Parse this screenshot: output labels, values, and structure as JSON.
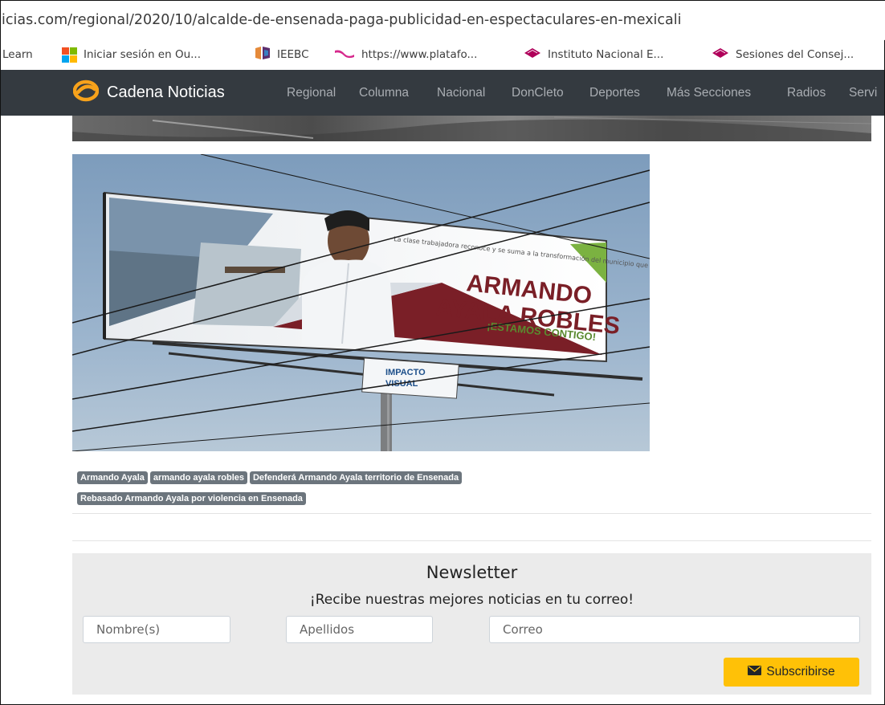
{
  "browser": {
    "url": "icias.com/regional/2020/10/alcalde-de-ensenada-paga-publicidad-en-espectaculares-en-mexicali",
    "bookmarks": [
      {
        "label": "Learn",
        "icon": "learn-bookmark"
      },
      {
        "label": "Iniciar sesión en Ou...",
        "icon": "microsoft-logo-icon"
      },
      {
        "label": "IEEBC",
        "icon": "ieebc-logo-icon"
      },
      {
        "label": "https://www.platafo...",
        "icon": "platform-logo-icon"
      },
      {
        "label": "Instituto Nacional E...",
        "icon": "ine-logo-icon"
      },
      {
        "label": "Sesiones del Consej...",
        "icon": "ine-logo-icon"
      }
    ]
  },
  "navbar": {
    "brand": "Cadena Noticias",
    "links": [
      "Regional",
      "Columna",
      "Nacional",
      "DonCleto",
      "Deportes",
      "Más Secciones",
      "Radios",
      "Servi"
    ]
  },
  "photo": {
    "billboard_text": {
      "slogan": "La clase trabajadora reconoce y se suma a la transformación del municipio que ha emprendido",
      "name_line1": "ARMANDO",
      "name_line2": "AYALA ROBLES",
      "tagline": "¡ESTAMOS CONTIGO!",
      "sign_line1": "IMPACTO",
      "sign_line2": "VISUAL"
    }
  },
  "tags": [
    "Armando Ayala",
    "armando ayala robles",
    "Defenderá Armando Ayala territorio de Ensenada",
    "Rebasado Armando Ayala por violencia en Ensenada"
  ],
  "newsletter": {
    "title": "Newsletter",
    "subtitle": "¡Recibe nuestras mejores noticias en tu correo!",
    "name_placeholder": "Nombre(s)",
    "lastname_placeholder": "Apellidos",
    "email_placeholder": "Correo",
    "button_label": "Subscribirse"
  },
  "colors": {
    "navbar": "#343a40",
    "brand_logo": "#f7a21b",
    "tag_bg": "#6c757d",
    "button_bg": "#ffc107",
    "newsletter_bg": "#ebebeb"
  }
}
